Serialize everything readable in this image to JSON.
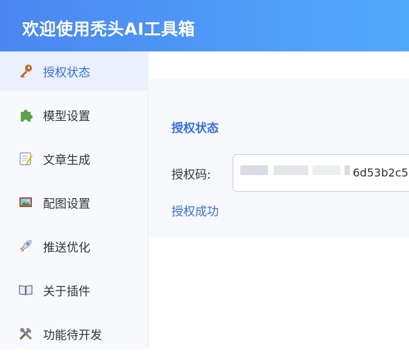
{
  "header": {
    "title": "欢迎使用秃头AI工具箱"
  },
  "sidebar": {
    "items": [
      {
        "label": "授权状态",
        "icon": "key-icon",
        "active": true
      },
      {
        "label": "模型设置",
        "icon": "puzzle-icon",
        "active": false
      },
      {
        "label": "文章生成",
        "icon": "memo-icon",
        "active": false
      },
      {
        "label": "配图设置",
        "icon": "picture-icon",
        "active": false
      },
      {
        "label": "推送优化",
        "icon": "rocket-icon",
        "active": false
      },
      {
        "label": "关于插件",
        "icon": "book-icon",
        "active": false
      },
      {
        "label": "功能待开发",
        "icon": "tools-icon",
        "active": false
      }
    ]
  },
  "main": {
    "card_title": "授权状态",
    "field_label": "授权码:",
    "field_value": "6d53b2c5",
    "status": "授权成功"
  },
  "colors": {
    "accent": "#3a6fd8",
    "header_start": "#4a86f0",
    "header_end": "#52a8fb"
  }
}
